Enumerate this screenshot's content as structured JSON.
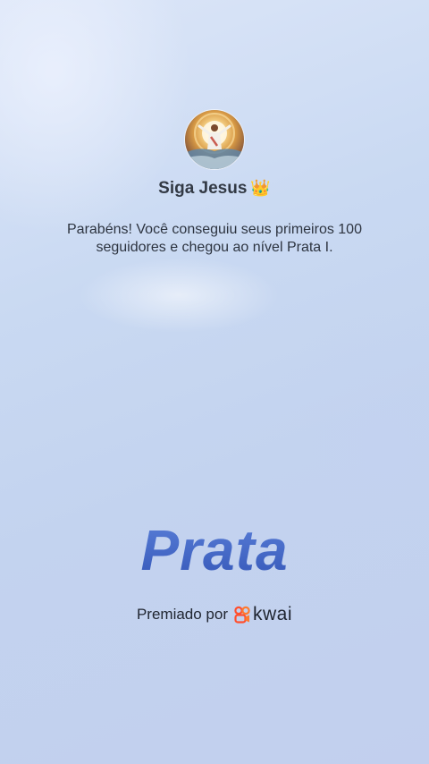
{
  "profile": {
    "username": "Siga Jesus",
    "badge_icon": "crown-emoji",
    "crown_glyph": "👑"
  },
  "message": "Parabéns! Você conseguiu seus primeiros 100 seguidores e chegou ao nível Prata I.",
  "level": {
    "name": "Prata",
    "color": "#3f66c6"
  },
  "awarded": {
    "label": "Premiado por",
    "brand": "kwai",
    "brand_icon": "kwai-logo-icon",
    "brand_color": "#ff4f2e"
  },
  "colors": {
    "background": "#c9d9f2",
    "text": "#2d3440"
  }
}
